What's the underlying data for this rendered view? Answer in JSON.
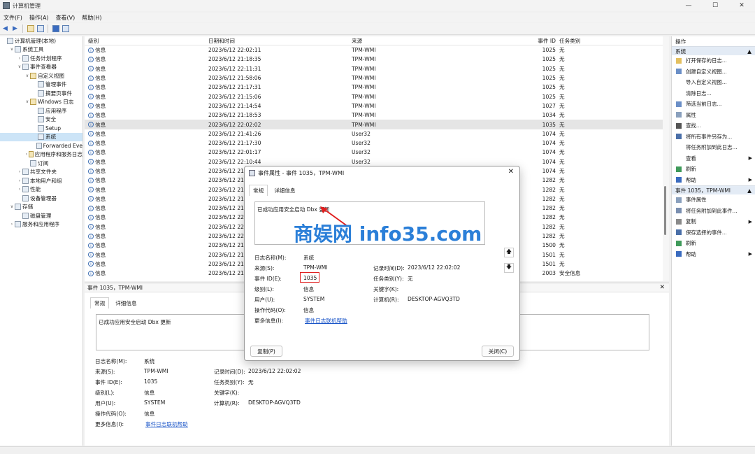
{
  "window": {
    "title": "计算机管理",
    "controls": [
      "—",
      "☐",
      "✕"
    ]
  },
  "menu": [
    "文件(F)",
    "操作(A)",
    "查看(V)",
    "帮助(H)"
  ],
  "tree": [
    {
      "label": "计算机管理(本地)",
      "depth": 0,
      "exp": ""
    },
    {
      "label": "系统工具",
      "depth": 1,
      "exp": "∨"
    },
    {
      "label": "任务计划程序",
      "depth": 2,
      "exp": "›"
    },
    {
      "label": "事件查看器",
      "depth": 2,
      "exp": "∨"
    },
    {
      "label": "自定义视图",
      "depth": 3,
      "exp": "∨"
    },
    {
      "label": "管理事件",
      "depth": 4,
      "exp": ""
    },
    {
      "label": "摘要页事件",
      "depth": 4,
      "exp": ""
    },
    {
      "label": "Windows 日志",
      "depth": 3,
      "exp": "∨"
    },
    {
      "label": "应用程序",
      "depth": 4,
      "exp": ""
    },
    {
      "label": "安全",
      "depth": 4,
      "exp": ""
    },
    {
      "label": "Setup",
      "depth": 4,
      "exp": ""
    },
    {
      "label": "系统",
      "depth": 4,
      "exp": "",
      "selected": true
    },
    {
      "label": "Forwarded Eve",
      "depth": 4,
      "exp": ""
    },
    {
      "label": "应用程序和服务日志",
      "depth": 3,
      "exp": "›"
    },
    {
      "label": "订阅",
      "depth": 3,
      "exp": ""
    },
    {
      "label": "共享文件夹",
      "depth": 2,
      "exp": "›"
    },
    {
      "label": "本地用户和组",
      "depth": 2,
      "exp": "›"
    },
    {
      "label": "性能",
      "depth": 2,
      "exp": "›"
    },
    {
      "label": "设备管理器",
      "depth": 2,
      "exp": ""
    },
    {
      "label": "存储",
      "depth": 1,
      "exp": "∨"
    },
    {
      "label": "磁盘管理",
      "depth": 2,
      "exp": ""
    },
    {
      "label": "服务和应用程序",
      "depth": 1,
      "exp": "›"
    }
  ],
  "list": {
    "headers": [
      "级别",
      "日期和时间",
      "来源",
      "事件 ID",
      "任务类别"
    ],
    "rows": [
      [
        "信息",
        "2023/6/12 22:02:11",
        "TPM-WMI",
        "1025",
        "无"
      ],
      [
        "信息",
        "2023/6/12 21:18:35",
        "TPM-WMI",
        "1025",
        "无"
      ],
      [
        "信息",
        "2023/6/12 22:11:31",
        "TPM-WMI",
        "1025",
        "无"
      ],
      [
        "信息",
        "2023/6/12 21:58:06",
        "TPM-WMI",
        "1025",
        "无"
      ],
      [
        "信息",
        "2023/6/12 21:17:31",
        "TPM-WMI",
        "1025",
        "无"
      ],
      [
        "信息",
        "2023/6/12 21:15:06",
        "TPM-WMI",
        "1025",
        "无"
      ],
      [
        "信息",
        "2023/6/12 21:14:54",
        "TPM-WMI",
        "1027",
        "无"
      ],
      [
        "信息",
        "2023/6/12 21:18:53",
        "TPM-WMI",
        "1034",
        "无"
      ],
      [
        "信息",
        "2023/6/12 22:02:02",
        "TPM-WMI",
        "1035",
        "无"
      ],
      [
        "信息",
        "2023/6/12 21:41:26",
        "User32",
        "1074",
        "无"
      ],
      [
        "信息",
        "2023/6/12 21:17:30",
        "User32",
        "1074",
        "无"
      ],
      [
        "信息",
        "2023/6/12 22:01:17",
        "User32",
        "1074",
        "无"
      ],
      [
        "信息",
        "2023/6/12 22:10:44",
        "User32",
        "1074",
        "无"
      ],
      [
        "信息",
        "2023/6/12 21",
        "",
        "1074",
        "无"
      ],
      [
        "信息",
        "2023/6/12 21",
        "",
        "1282",
        "无"
      ],
      [
        "信息",
        "2023/6/12 21",
        "",
        "1282",
        "无"
      ],
      [
        "信息",
        "2023/6/12 21",
        "",
        "1282",
        "无"
      ],
      [
        "信息",
        "2023/6/12 21",
        "",
        "1282",
        "无"
      ],
      [
        "信息",
        "2023/6/12 22",
        "",
        "1282",
        "无"
      ],
      [
        "信息",
        "2023/6/12 22",
        "",
        "1282",
        "无"
      ],
      [
        "信息",
        "2023/6/12 22",
        "",
        "1282",
        "无"
      ],
      [
        "信息",
        "2023/6/12 21",
        "",
        "1500",
        "无"
      ],
      [
        "信息",
        "2023/6/12 21",
        "",
        "1501",
        "无"
      ],
      [
        "信息",
        "2023/6/12 21",
        "",
        "1501",
        "无"
      ],
      [
        "信息",
        "2023/6/12 21",
        "",
        "2003",
        "安全信息"
      ]
    ],
    "selected_index": 8
  },
  "detail": {
    "header": "事件 1035，TPM-WMI",
    "tabs": [
      "常规",
      "详细信息"
    ],
    "message": "已成功应用安全启动 Dbx 更新",
    "labels": {
      "log": "日志名称(M):",
      "source": "来源(S):",
      "eventid": "事件 ID(E):",
      "level": "级别(L):",
      "user": "用户(U):",
      "opcode": "操作代码(O):",
      "moreinfo": "更多信息(I):",
      "logged": "记录时间(D):",
      "task": "任务类别(Y):",
      "keywords": "关键字(K):",
      "computer": "计算机(R):"
    },
    "values": {
      "log": "系统",
      "source": "TPM-WMI",
      "eventid": "1035",
      "level": "信息",
      "user": "SYSTEM",
      "opcode": "信息",
      "moreinfo": "事件日志联机帮助",
      "logged": "2023/6/12 22:02:02",
      "task": "无",
      "keywords": "",
      "computer": "DESKTOP-AGVQ3TD"
    }
  },
  "dialog": {
    "title": "事件属性 - 事件 1035，TPM-WMI",
    "copy_button": "复制(P)",
    "close_button": "关闭(C)"
  },
  "actions": {
    "title": "操作",
    "section1": "系统",
    "items1": [
      {
        "label": "打开保存的日志...",
        "icon": "folder-icon",
        "arrow": false
      },
      {
        "label": "创建自定义视图...",
        "icon": "filter-icon",
        "arrow": false
      },
      {
        "label": "导入自定义视图...",
        "icon": "",
        "arrow": false
      },
      {
        "label": "清除日志...",
        "icon": "",
        "arrow": false
      },
      {
        "label": "筛选当前日志...",
        "icon": "filter-icon",
        "arrow": false
      },
      {
        "label": "属性",
        "icon": "properties-icon",
        "arrow": false
      },
      {
        "label": "查找...",
        "icon": "find-icon",
        "arrow": false
      },
      {
        "label": "将所有事件另存为...",
        "icon": "save-icon",
        "arrow": false
      },
      {
        "label": "将任务附加到此日志...",
        "icon": "",
        "arrow": false
      },
      {
        "label": "查看",
        "icon": "",
        "arrow": true
      },
      {
        "label": "刷新",
        "icon": "refresh-icon",
        "arrow": false
      },
      {
        "label": "帮助",
        "icon": "help-icon",
        "arrow": true
      }
    ],
    "section2": "事件 1035，TPM-WMI",
    "items2": [
      {
        "label": "事件属性",
        "icon": "properties-icon",
        "arrow": false
      },
      {
        "label": "将任务附加到此事件...",
        "icon": "task-icon",
        "arrow": false
      },
      {
        "label": "复制",
        "icon": "copy-icon",
        "arrow": true
      },
      {
        "label": "保存选择的事件...",
        "icon": "save-icon",
        "arrow": false
      },
      {
        "label": "刷新",
        "icon": "refresh-icon",
        "arrow": false
      },
      {
        "label": "帮助",
        "icon": "help-icon",
        "arrow": true
      }
    ]
  },
  "watermark": "商娱网 info35.com",
  "colors": {
    "selection": "#cce4f7",
    "link": "#1a55c8",
    "highlight_box": "#e02020",
    "watermark": "#2b7fd8",
    "action_section": "#e3ebf5"
  }
}
